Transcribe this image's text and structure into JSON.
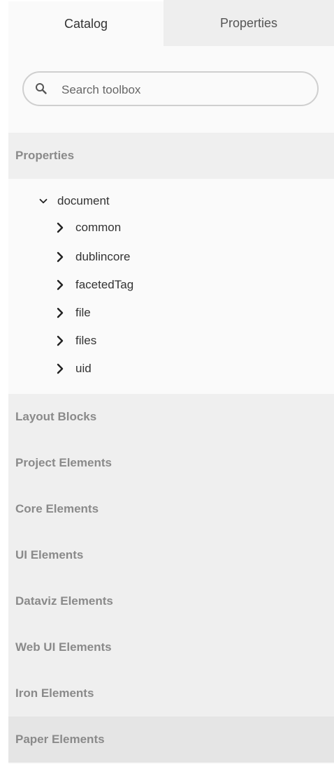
{
  "tabs": [
    {
      "label": "Catalog",
      "active": true
    },
    {
      "label": "Properties",
      "active": false
    }
  ],
  "search": {
    "placeholder": "Search toolbox",
    "value": ""
  },
  "sections": {
    "properties": "Properties",
    "layout_blocks": "Layout Blocks",
    "project_elements": "Project Elements",
    "core_elements": "Core Elements",
    "ui_elements": "UI Elements",
    "dataviz_elements": "Dataviz Elements",
    "web_ui_elements": "Web UI Elements",
    "iron_elements": "Iron Elements",
    "paper_elements": "Paper Elements"
  },
  "tree": {
    "root": {
      "label": "document",
      "expanded": true
    },
    "children": [
      {
        "label": "common"
      },
      {
        "label": "dublincore"
      },
      {
        "label": "facetedTag"
      },
      {
        "label": "file"
      },
      {
        "label": "files"
      },
      {
        "label": "uid"
      }
    ]
  },
  "colors": {
    "panel_bg": "#fafafa",
    "section_bg": "#efefef",
    "section_text": "#8a8a8a",
    "tab_inactive_bg": "#eeeeee",
    "text": "#333333"
  },
  "icons": {
    "search": "search-icon",
    "expanded": "chevron-down-icon",
    "collapsed": "chevron-right-icon"
  }
}
